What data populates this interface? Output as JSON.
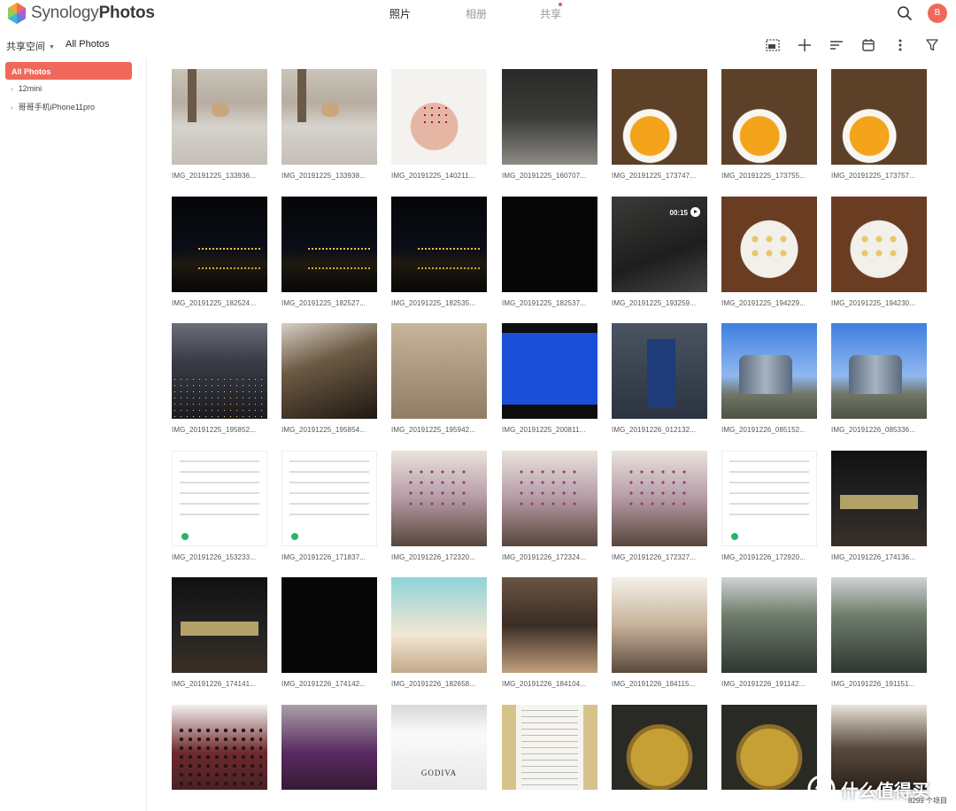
{
  "app": {
    "brand_light": "Synology",
    "brand_bold": "Photos",
    "avatar_initial": "B"
  },
  "nav": {
    "tabs": [
      "照片",
      "相册",
      "共享"
    ],
    "active": 0
  },
  "subbar": {
    "space_label": "共享空间",
    "breadcrumb": "All Photos"
  },
  "toolbar": {
    "icons": [
      "select-icon",
      "add-icon",
      "sort-icon",
      "calendar-icon",
      "more-icon",
      "filter-icon"
    ]
  },
  "sidebar": {
    "active_item": "All Photos",
    "items": [
      "12mini",
      "哥哥手机iPhone11pro"
    ]
  },
  "grid": {
    "photos": [
      {
        "name": "IMG_20191225_133936...",
        "theme": "t-dog"
      },
      {
        "name": "IMG_20191225_133938...",
        "theme": "t-dog"
      },
      {
        "name": "IMG_20191225_140211...",
        "theme": "t-hand"
      },
      {
        "name": "IMG_20191225_160707...",
        "theme": "t-feet"
      },
      {
        "name": "IMG_20191225_173747...",
        "theme": "t-soup"
      },
      {
        "name": "IMG_20191225_173755...",
        "theme": "t-soup"
      },
      {
        "name": "IMG_20191225_173757...",
        "theme": "t-soup"
      },
      {
        "name": "IMG_20191225_182524...",
        "theme": "t-night"
      },
      {
        "name": "IMG_20191225_182527...",
        "theme": "t-night"
      },
      {
        "name": "IMG_20191225_182535...",
        "theme": "t-night"
      },
      {
        "name": "IMG_20191225_182537...",
        "theme": "t-dark"
      },
      {
        "name": "IMG_20191225_193259...",
        "theme": "t-room",
        "duration": "00:15"
      },
      {
        "name": "IMG_20191225_194229...",
        "theme": "t-food"
      },
      {
        "name": "IMG_20191225_194230...",
        "theme": "t-food"
      },
      {
        "name": "IMG_20191225_195852...",
        "theme": "t-city"
      },
      {
        "name": "IMG_20191225_195854...",
        "theme": "t-car"
      },
      {
        "name": "IMG_20191225_195942...",
        "theme": "t-floor"
      },
      {
        "name": "IMG_20191225_200811...",
        "theme": "t-screen"
      },
      {
        "name": "IMG_20191226_012132...",
        "theme": "t-match"
      },
      {
        "name": "IMG_20191226_085152...",
        "theme": "t-sky"
      },
      {
        "name": "IMG_20191226_085336...",
        "theme": "t-sky"
      },
      {
        "name": "IMG_20191226_153233...",
        "theme": "t-app"
      },
      {
        "name": "IMG_20191226_171837...",
        "theme": "t-app"
      },
      {
        "name": "IMG_20191226_172320...",
        "theme": "t-flower"
      },
      {
        "name": "IMG_20191226_172324...",
        "theme": "t-flower"
      },
      {
        "name": "IMG_20191226_172327...",
        "theme": "t-flower"
      },
      {
        "name": "IMG_20191226_172920...",
        "theme": "t-app"
      },
      {
        "name": "IMG_20191226_174136...",
        "theme": "t-shop"
      },
      {
        "name": "IMG_20191226_174141...",
        "theme": "t-shop"
      },
      {
        "name": "IMG_20191226_174142...",
        "theme": "t-dark"
      },
      {
        "name": "IMG_20191226_182658...",
        "theme": "t-kids"
      },
      {
        "name": "IMG_20191226_184104...",
        "theme": "t-mall"
      },
      {
        "name": "IMG_20191226_184115...",
        "theme": "t-mall2"
      },
      {
        "name": "IMG_20191226_191142...",
        "theme": "t-esc"
      },
      {
        "name": "IMG_20191226_191151...",
        "theme": "t-esc"
      },
      {
        "name": "",
        "theme": "t-choc"
      },
      {
        "name": "",
        "theme": "t-choc2"
      },
      {
        "name": "",
        "theme": "t-bag",
        "print": "GODIVA"
      },
      {
        "name": "",
        "theme": "t-receipt"
      },
      {
        "name": "",
        "theme": "t-noodle"
      },
      {
        "name": "",
        "theme": "t-noodle"
      },
      {
        "name": "",
        "theme": "t-coffee"
      }
    ]
  },
  "footer": {
    "count": "8299 个项目",
    "watermark": "什么值得买"
  },
  "colors": {
    "accent": "#f0685a",
    "nav_dot": "#ef5350"
  }
}
